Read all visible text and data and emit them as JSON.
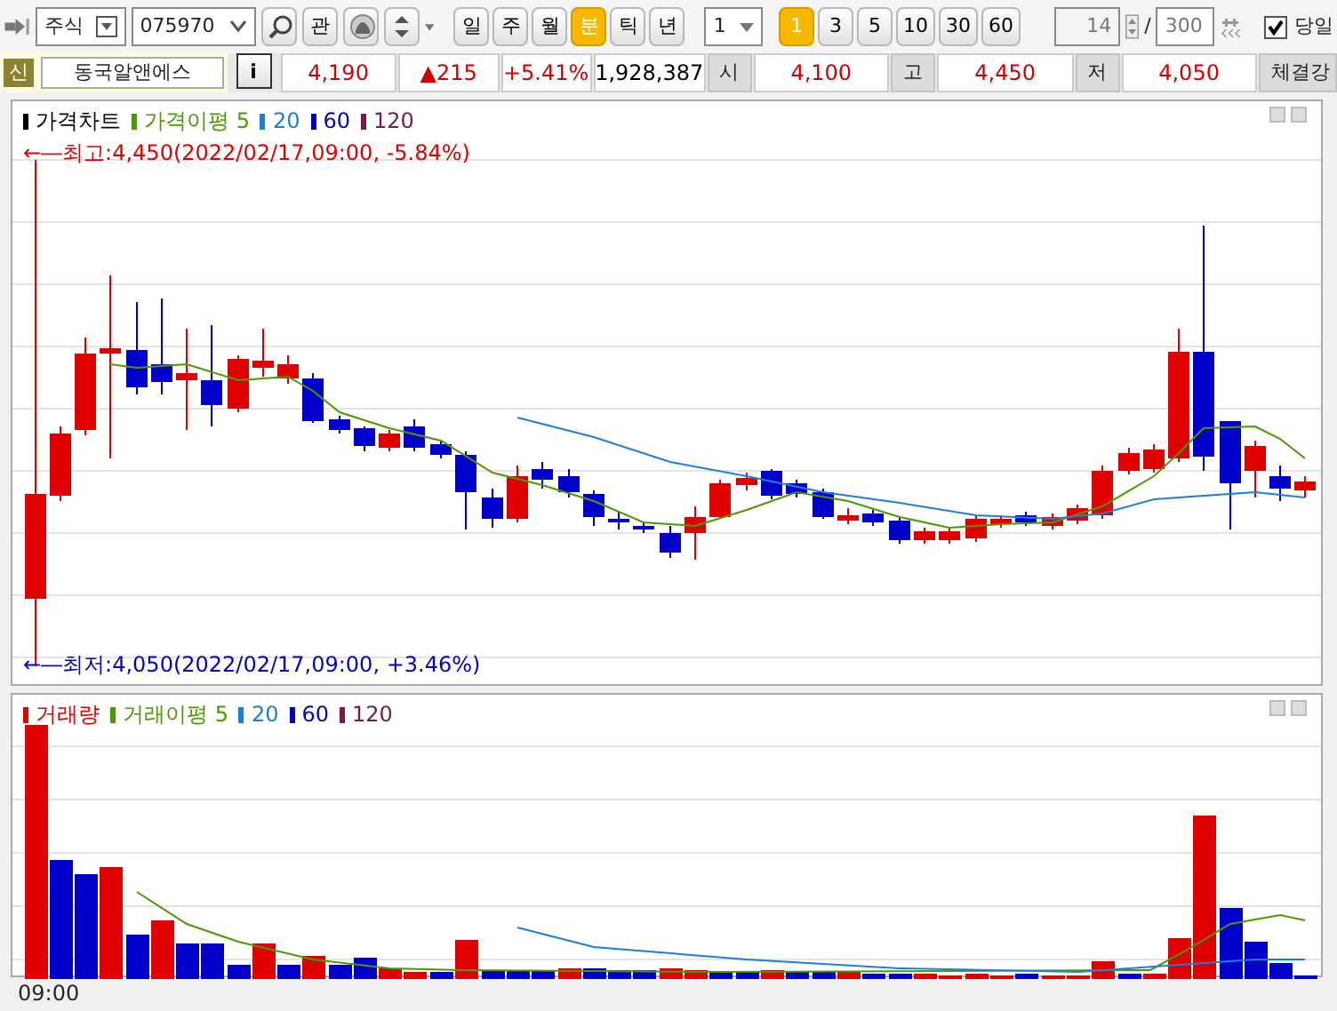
{
  "toolbar": {
    "market": "주식",
    "code": "075970",
    "watch_button": "관",
    "periods": [
      {
        "label": "일",
        "selected": false
      },
      {
        "label": "주",
        "selected": false
      },
      {
        "label": "월",
        "selected": false
      },
      {
        "label": "분",
        "selected": true
      },
      {
        "label": "틱",
        "selected": false
      },
      {
        "label": "년",
        "selected": false
      }
    ],
    "interval": "1",
    "minutes": [
      {
        "label": "1",
        "selected": true
      },
      {
        "label": "3",
        "selected": false
      },
      {
        "label": "5",
        "selected": false
      },
      {
        "label": "10",
        "selected": false
      },
      {
        "label": "30",
        "selected": false
      },
      {
        "label": "60",
        "selected": false
      }
    ],
    "count": "14",
    "separator": "/",
    "total": "300",
    "today": {
      "label": "당일",
      "checked": true
    }
  },
  "quote": {
    "badge": "신",
    "name": "동국알앤에스",
    "info": "i",
    "price": "4,190",
    "change": "▲215",
    "rate": "+5.41%",
    "volume": "1,928,387",
    "fields": [
      {
        "label": "시",
        "value": "4,100"
      },
      {
        "label": "고",
        "value": "4,450"
      },
      {
        "label": "저",
        "value": "4,050"
      }
    ],
    "last_label": "체결강"
  },
  "price_chart": {
    "legend": [
      {
        "label": "가격차트",
        "color": "#000000"
      },
      {
        "label": "가격이평 5",
        "color": "#4a9a00"
      },
      {
        "label": "20",
        "color": "#1a80d8"
      },
      {
        "label": "60",
        "color": "#0000c0"
      },
      {
        "label": "120",
        "color": "#7a1a48"
      }
    ],
    "high_note": "←―최고:4,450(2022/02/17,09:00, -5.84%)",
    "low_note": "←―최저:4,050(2022/02/17,09:00, +3.46%)"
  },
  "volume_chart": {
    "legend": [
      {
        "label": "거래량",
        "color": "#e00000"
      },
      {
        "label": "거래이평 5",
        "color": "#4a9a00"
      },
      {
        "label": "20",
        "color": "#1a80d8"
      },
      {
        "label": "60",
        "color": "#0000c0"
      },
      {
        "label": "120",
        "color": "#7a1a48"
      }
    ]
  },
  "time_label": "09:00"
}
